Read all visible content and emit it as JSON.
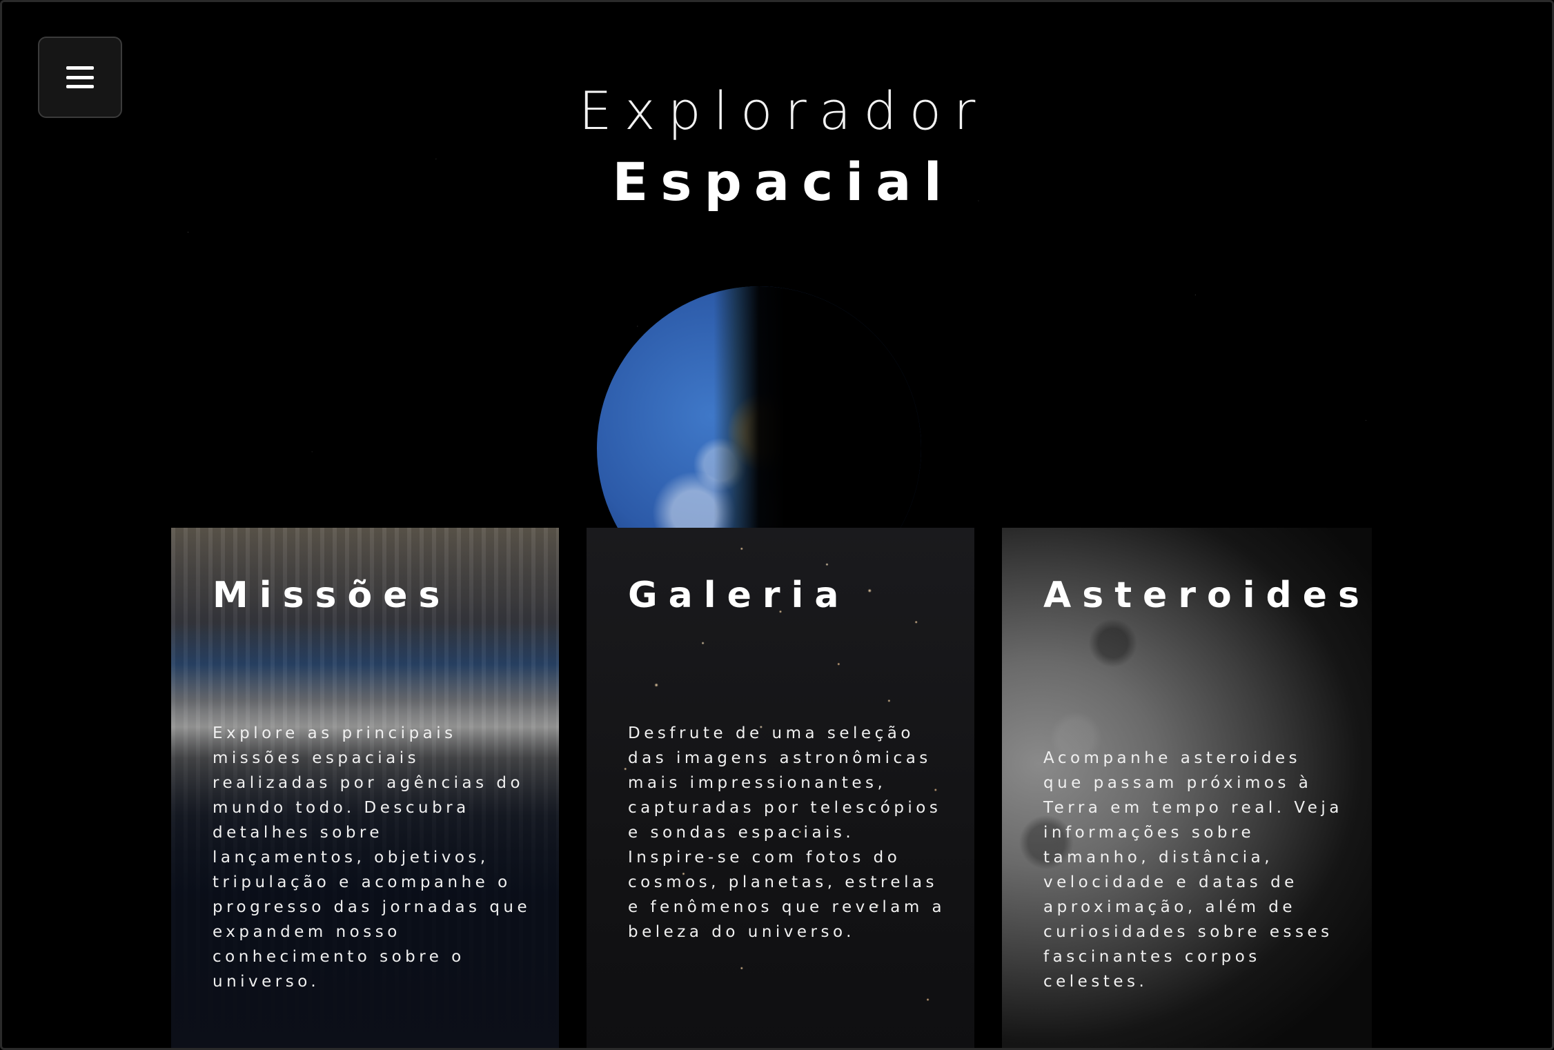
{
  "header": {
    "title_line1": "Explorador",
    "title_line2": "Espacial"
  },
  "menu": {
    "icon": "hamburger-menu-icon"
  },
  "cards": [
    {
      "title": "Missões",
      "description": "Explore as principais missões espaciais realizadas por agências do mundo todo. Descubra detalhes sobre lançamentos, objetivos, tripulação e acompanhe o progresso das jornadas que expandem nosso conhecimento sobre o universo."
    },
    {
      "title": "Galeria",
      "description": "Desfrute de uma seleção das imagens astronômicas mais impressionantes, capturadas por telescópios e sondas espaciais. Inspire-se com fotos do cosmos, planetas, estrelas e fenômenos que revelam a beleza do universo."
    },
    {
      "title": "Asteroides",
      "description": "Acompanhe asteroides que passam próximos à Terra em tempo real. Veja informações sobre tamanho, distância, velocidade e datas de aproximação, além de curiosidades sobre esses fascinantes corpos celestes."
    }
  ],
  "colors": {
    "background": "#000000",
    "menu_bg": "#161616",
    "text": "#ffffff"
  }
}
